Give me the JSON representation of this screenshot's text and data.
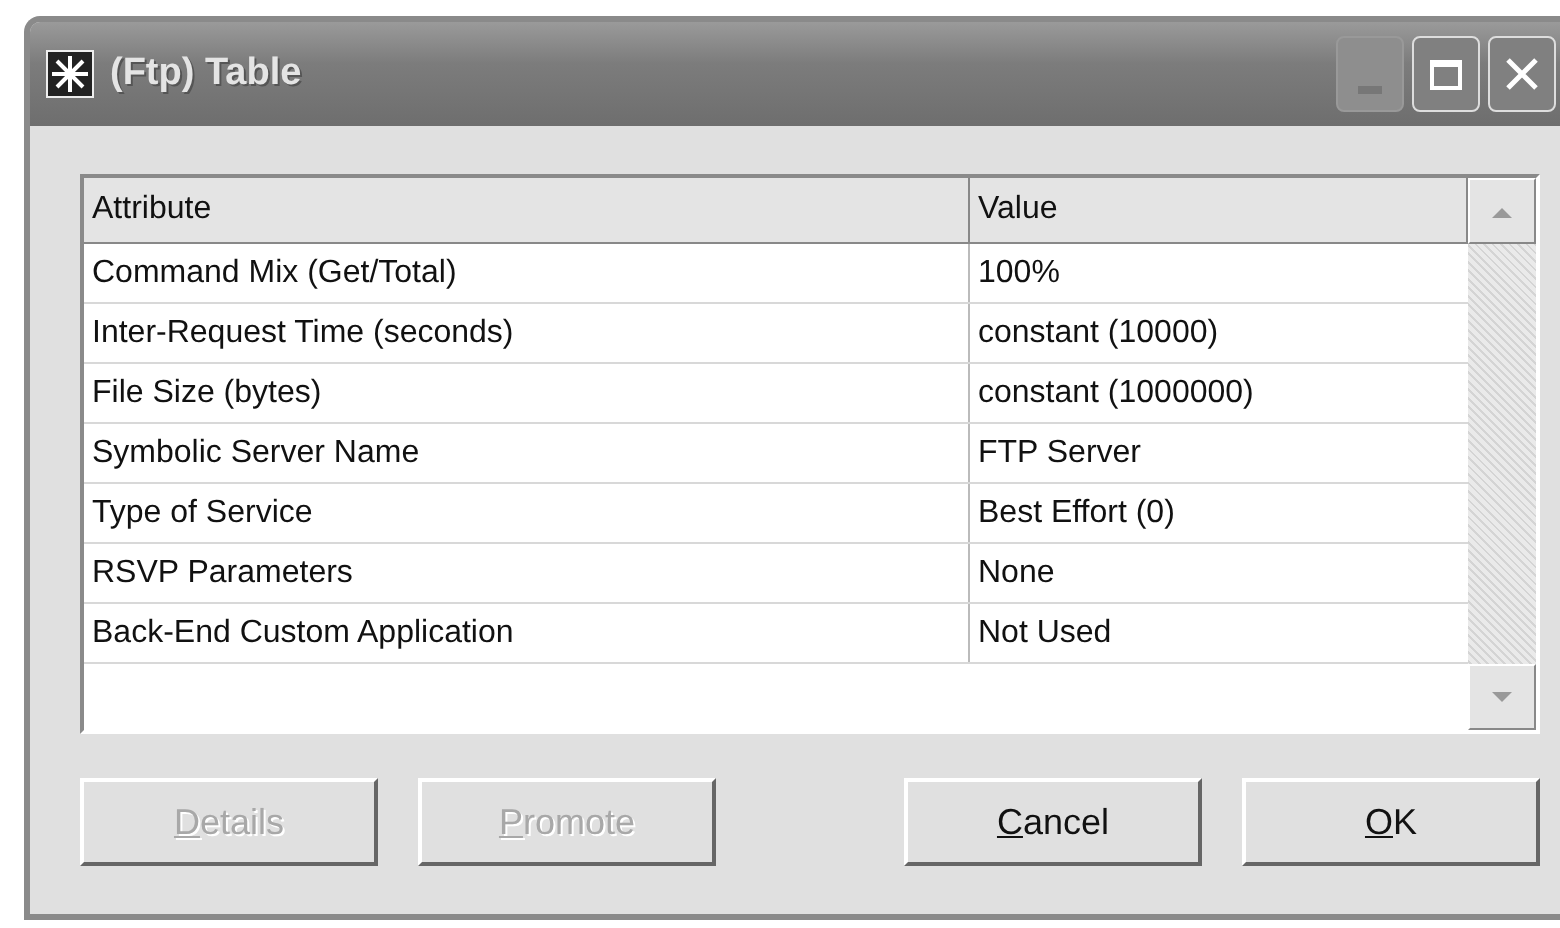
{
  "window": {
    "title": "(Ftp) Table",
    "controls": [
      {
        "kind": "minimize",
        "disabled": true
      },
      {
        "kind": "maximize",
        "disabled": false
      },
      {
        "kind": "close",
        "disabled": false
      }
    ]
  },
  "table": {
    "columns": [
      "Attribute",
      "Value"
    ],
    "rows": [
      {
        "attribute": "Command Mix (Get/Total)",
        "value": "100%"
      },
      {
        "attribute": "Inter-Request Time (seconds)",
        "value": "constant (10000)"
      },
      {
        "attribute": "File Size (bytes)",
        "value": "constant (1000000)"
      },
      {
        "attribute": "Symbolic Server Name",
        "value": "FTP Server"
      },
      {
        "attribute": "Type of Service",
        "value": "Best Effort (0)"
      },
      {
        "attribute": "RSVP Parameters",
        "value": "None"
      },
      {
        "attribute": "Back-End Custom Application",
        "value": "Not Used"
      }
    ]
  },
  "buttons": [
    {
      "label": "Details",
      "disabled": true,
      "mnemonic": true
    },
    {
      "label": "Promote",
      "disabled": true,
      "mnemonic": true
    },
    {
      "label": "Cancel",
      "disabled": false,
      "mnemonic": true
    },
    {
      "label": "OK",
      "disabled": false,
      "mnemonic": true
    }
  ]
}
